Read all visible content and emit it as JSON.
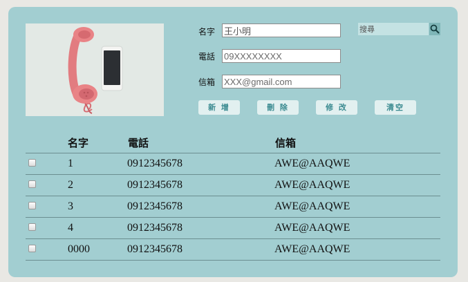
{
  "form": {
    "name_label": "名字",
    "name_value": "王小明",
    "phone_label": "電話",
    "phone_placeholder": "09XXXXXXXX",
    "email_label": "信箱",
    "email_placeholder": "XXX@gmail.com"
  },
  "search": {
    "placeholder": "搜尋",
    "icon": "search-icon"
  },
  "buttons": {
    "add": "新 增",
    "delete": "刪 除",
    "edit": "修 改",
    "clear": "清空"
  },
  "table": {
    "headers": [
      "名字",
      "電話",
      "信箱"
    ],
    "rows": [
      {
        "name": "1",
        "phone": "0912345678",
        "email": "AWE@AAQWE"
      },
      {
        "name": "2",
        "phone": "0912345678",
        "email": "AWE@AAQWE"
      },
      {
        "name": "3",
        "phone": "0912345678",
        "email": "AWE@AAQWE"
      },
      {
        "name": "4",
        "phone": "0912345678",
        "email": "AWE@AAQWE"
      },
      {
        "name": "0000",
        "phone": "0912345678",
        "email": "AWE@AAQWE"
      }
    ]
  },
  "colors": {
    "card_bg": "#a2ced1",
    "page_bg": "#e9e8e4",
    "button_text": "#3a8a90"
  }
}
